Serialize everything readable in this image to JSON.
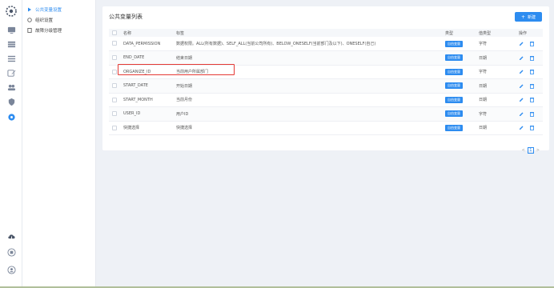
{
  "sidebar": {
    "icons": [
      "logo-icon",
      "monitor-icon",
      "grid-icon",
      "list-icon",
      "edit-icon",
      "group-icon",
      "shield-icon",
      "gear-icon",
      "cloud-upload-icon",
      "printer-icon",
      "user-icon"
    ]
  },
  "submenu": {
    "items": [
      {
        "label": "公共变量设置",
        "icon": "play-icon"
      },
      {
        "label": "组织设置",
        "icon": "gear-icon"
      },
      {
        "label": "故障分级管理",
        "icon": "doc-icon"
      }
    ]
  },
  "card": {
    "title": "公共变量列表",
    "new_button": "新建"
  },
  "table": {
    "columns": [
      "名称",
      "标签",
      "类型",
      "值类型",
      "操作"
    ],
    "rows": [
      {
        "name": "DATA_PERMISSION",
        "label": "数据权限。ALL(所有数据)、SELF_ALL(当前公司所有)、BELOW_ONESELF(当前部门及以下)、ONESELF(自己)",
        "type": "自由变量",
        "value_type": "字符"
      },
      {
        "name": "END_DATE",
        "label": "结束日期",
        "type": "自由变量",
        "value_type": "日期"
      },
      {
        "name": "ORGANIZE_ID",
        "label": "当前用户所属部门",
        "type": "自由变量",
        "value_type": "字符"
      },
      {
        "name": "START_DATE",
        "label": "开始日期",
        "type": "自由变量",
        "value_type": "日期"
      },
      {
        "name": "START_MONTH",
        "label": "当前月份",
        "type": "自由变量",
        "value_type": "日期"
      },
      {
        "name": "USER_ID",
        "label": "用户ID",
        "type": "自由变量",
        "value_type": "字符"
      },
      {
        "name": "快捷选择",
        "label": "快捷选择",
        "type": "自由变量",
        "value_type": "日期"
      }
    ]
  },
  "pager": {
    "prev": "<",
    "current": "1",
    "next": ">"
  },
  "colors": {
    "accent": "#2d8cf0",
    "highlight": "#e53935"
  }
}
